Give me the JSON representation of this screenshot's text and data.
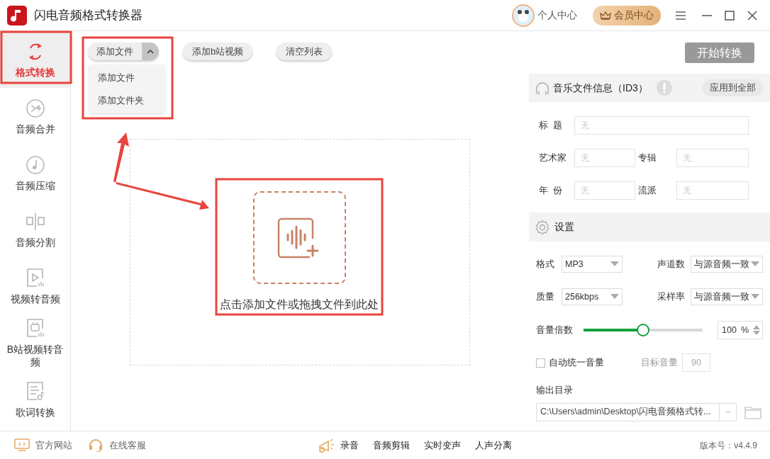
{
  "window": {
    "title": "闪电音频格式转换器",
    "user_label": "个人中心",
    "vip_label": "会员中心"
  },
  "sidebar": {
    "items": [
      {
        "label": "格式转换",
        "kind": "convert",
        "selected": true
      },
      {
        "label": "音频合并",
        "kind": "merge",
        "selected": false
      },
      {
        "label": "音频压缩",
        "kind": "compress",
        "selected": false
      },
      {
        "label": "音频分割",
        "kind": "split",
        "selected": false
      },
      {
        "label": "视频转音频",
        "kind": "video",
        "selected": false
      },
      {
        "label": "B站视频转音频",
        "kind": "bilibili",
        "selected": false
      },
      {
        "label": "歌词转换",
        "kind": "lyrics",
        "selected": false
      }
    ]
  },
  "toolbar": {
    "add_file": {
      "label": "添加文件",
      "expanded": true,
      "menu": [
        "添加文件",
        "添加文件夹"
      ]
    },
    "buttons": [
      "添加b站视频",
      "清空列表"
    ]
  },
  "drop_zone": {
    "text": "点击添加文件或拖拽文件到此处"
  },
  "start_button": "开始转换",
  "id3": {
    "title": "音乐文件信息（ID3）",
    "apply_all": "应用到全部",
    "fields": [
      {
        "label": "标  题",
        "placeholder": "无",
        "wide": true
      },
      {
        "label": "艺术家",
        "placeholder": "无",
        "wide": false
      },
      {
        "label": "专辑",
        "placeholder": "无",
        "wide": false
      },
      {
        "label": "年  份",
        "placeholder": "无",
        "wide": false
      },
      {
        "label": "流派",
        "placeholder": "无",
        "wide": false
      }
    ]
  },
  "settings": {
    "title": "设置",
    "selects": [
      {
        "label": "格式",
        "value": "MP3"
      },
      {
        "label": "声道数",
        "value": "与源音频一致"
      },
      {
        "label": "质量",
        "value": "256kbps"
      },
      {
        "label": "采样率",
        "value": "与源音频一致"
      }
    ],
    "volume": {
      "label": "音量倍数",
      "level": 0.5,
      "value": "100",
      "unit": "%"
    },
    "auto_normalize": {
      "label": "自动统一音量",
      "checked": false
    },
    "target_volume": {
      "label": "目标音量",
      "value": "90"
    },
    "output": {
      "label": "输出目录",
      "path": "C:\\Users\\admin\\Desktop\\闪电音频格式转..."
    }
  },
  "footer": {
    "links": [
      {
        "label": "官方网站",
        "kind": "website"
      },
      {
        "label": "在线客服",
        "kind": "support"
      }
    ],
    "tools": [
      "录音",
      "音频剪辑",
      "实时变声",
      "人声分离"
    ],
    "version": "版本号：v4.4.9"
  }
}
